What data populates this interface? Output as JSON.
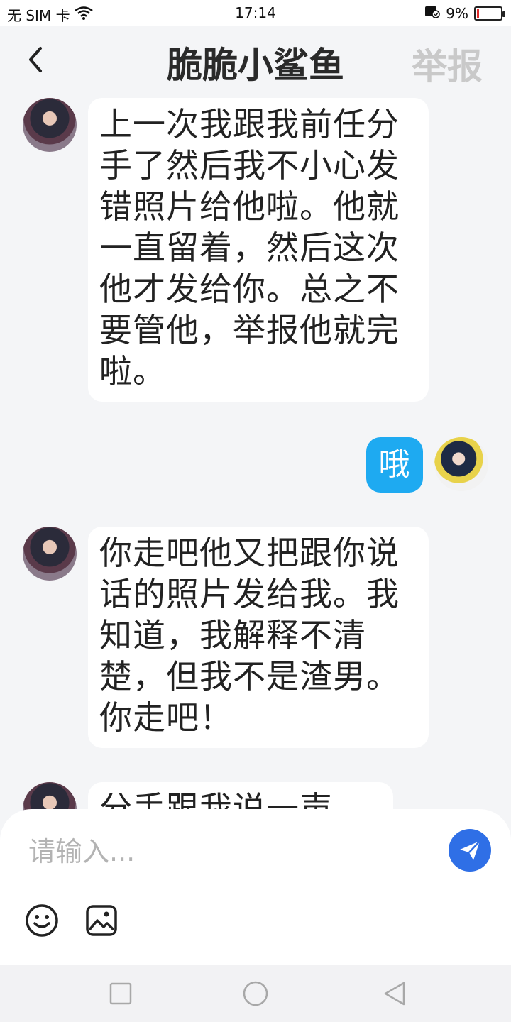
{
  "status_bar": {
    "carrier": "无 SIM 卡",
    "time": "17:14",
    "battery_percent": "9%",
    "battery_level": 0.09
  },
  "header": {
    "back_icon": "chevron-left-icon",
    "title": "脆脆小鲨鱼",
    "report_label": "举报"
  },
  "messages": [
    {
      "from": "other",
      "text": "上一次我跟我前任分手了然后我不小心发错照片给他啦。他就一直留着，然后这次他才发给你。总之不要管他，举报他就完啦。"
    },
    {
      "from": "self",
      "text": "哦"
    },
    {
      "from": "other",
      "text": "你走吧他又把跟你说话的照片发给我。我知道，我解释不清楚，但我不是渣男。你走吧！"
    },
    {
      "from": "other",
      "text": "分手跟我说一声"
    }
  ],
  "composer": {
    "placeholder": "请输入...",
    "value": "",
    "send_icon": "send-icon",
    "emoji_icon": "emoji-icon",
    "image_icon": "image-icon"
  },
  "colors": {
    "accent_blue": "#2f6fe6",
    "outgoing_bubble": "#1eaaf1",
    "background": "#f4f5f7"
  }
}
